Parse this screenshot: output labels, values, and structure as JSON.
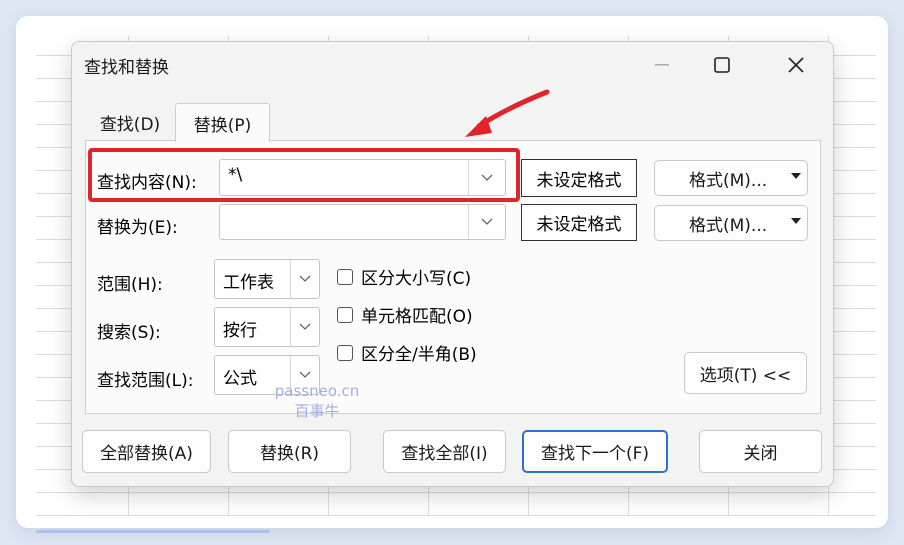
{
  "dialog": {
    "title": "查找和替换",
    "tabs": [
      {
        "label": "查找(D)"
      },
      {
        "label": "替换(P)"
      }
    ]
  },
  "find_row": {
    "label": "查找内容(N):",
    "value": "*\\",
    "format_status": "未设定格式",
    "format_button": "格式(M)..."
  },
  "replace_row": {
    "label": "替换为(E):",
    "value": "",
    "format_status": "未设定格式",
    "format_button": "格式(M)..."
  },
  "options": {
    "scope_label": "范围(H):",
    "scope_value": "工作表",
    "search_label": "搜索(S):",
    "search_value": "按行",
    "lookin_label": "查找范围(L):",
    "lookin_value": "公式",
    "checkboxes": [
      {
        "label": "区分大小写(C)",
        "checked": false
      },
      {
        "label": "单元格匹配(O)",
        "checked": false
      },
      {
        "label": "区分全/半角(B)",
        "checked": false
      }
    ],
    "options_button": "选项(T) <<"
  },
  "buttons": {
    "replace_all": "全部替换(A)",
    "replace": "替换(R)",
    "find_all": "查找全部(I)",
    "find_next": "查找下一个(F)",
    "close": "关闭"
  },
  "watermark": {
    "line1": "passneo.cn",
    "line2": "百事牛"
  },
  "colors": {
    "highlight_red": "#e0242a",
    "primary_border": "#2f6fd0"
  }
}
